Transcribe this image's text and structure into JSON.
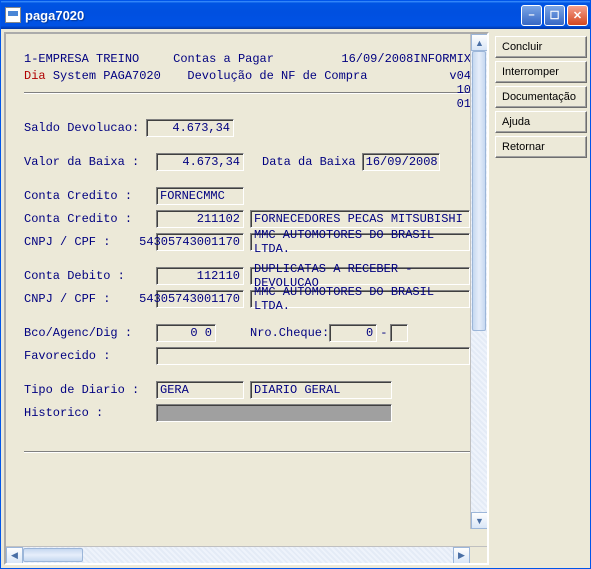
{
  "window": {
    "title": "paga7020"
  },
  "header": {
    "company": "1-EMPRESA TREINO",
    "module": "Contas a Pagar",
    "date": "16/09/2008",
    "user": "INFORMIX",
    "sys_prefix": "Dia",
    "sys_label": "System  PAGA7020",
    "screen_title": "Devolução de NF de Compra",
    "version": "v04 10 01"
  },
  "form": {
    "saldo_devolucao": {
      "label": "Saldo Devolucao:",
      "value": "4.673,34"
    },
    "valor_baixa": {
      "label": "Valor da Baixa :",
      "value": "4.673,34"
    },
    "data_baixa": {
      "label": "Data da Baixa",
      "value": "16/09/2008"
    },
    "conta_credito_txt": {
      "label": "Conta Credito  :",
      "value": "FORNECMMC"
    },
    "conta_credito_num": {
      "label": "Conta Credito  :",
      "value": "211102",
      "desc": "FORNECEDORES PECAS MITSUBISHI"
    },
    "cnpj1": {
      "label": "CNPJ / CPF     :",
      "value": "54305743001170",
      "desc": "MMC AUTOMOTORES DO BRASIL LTDA."
    },
    "conta_debito": {
      "label": "Conta Debito   :",
      "value": "112110",
      "desc": "DUPLICATAS A RECEBER - DEVOLUCAO"
    },
    "cnpj2": {
      "label": "CNPJ / CPF     :",
      "value": "54305743001170",
      "desc": "MMC AUTOMOTORES DO BRASIL LTDA."
    },
    "bco": {
      "label": "Bco/Agenc/Dig  :",
      "value": "0 0"
    },
    "cheque": {
      "label": "Nro.Cheque:",
      "value": "0",
      "suffix": "-"
    },
    "favorecido": {
      "label": "Favorecido     :",
      "value": ""
    },
    "tipo_diario": {
      "label": "Tipo de Diario :",
      "value": "GERA",
      "desc": "DIARIO GERAL"
    },
    "historico": {
      "label": "Historico      :",
      "value": ""
    }
  },
  "buttons": {
    "concluir": "Concluir",
    "interromper": "Interromper",
    "documentacao": "Documentação",
    "ajuda": "Ajuda",
    "retornar": "Retornar"
  }
}
